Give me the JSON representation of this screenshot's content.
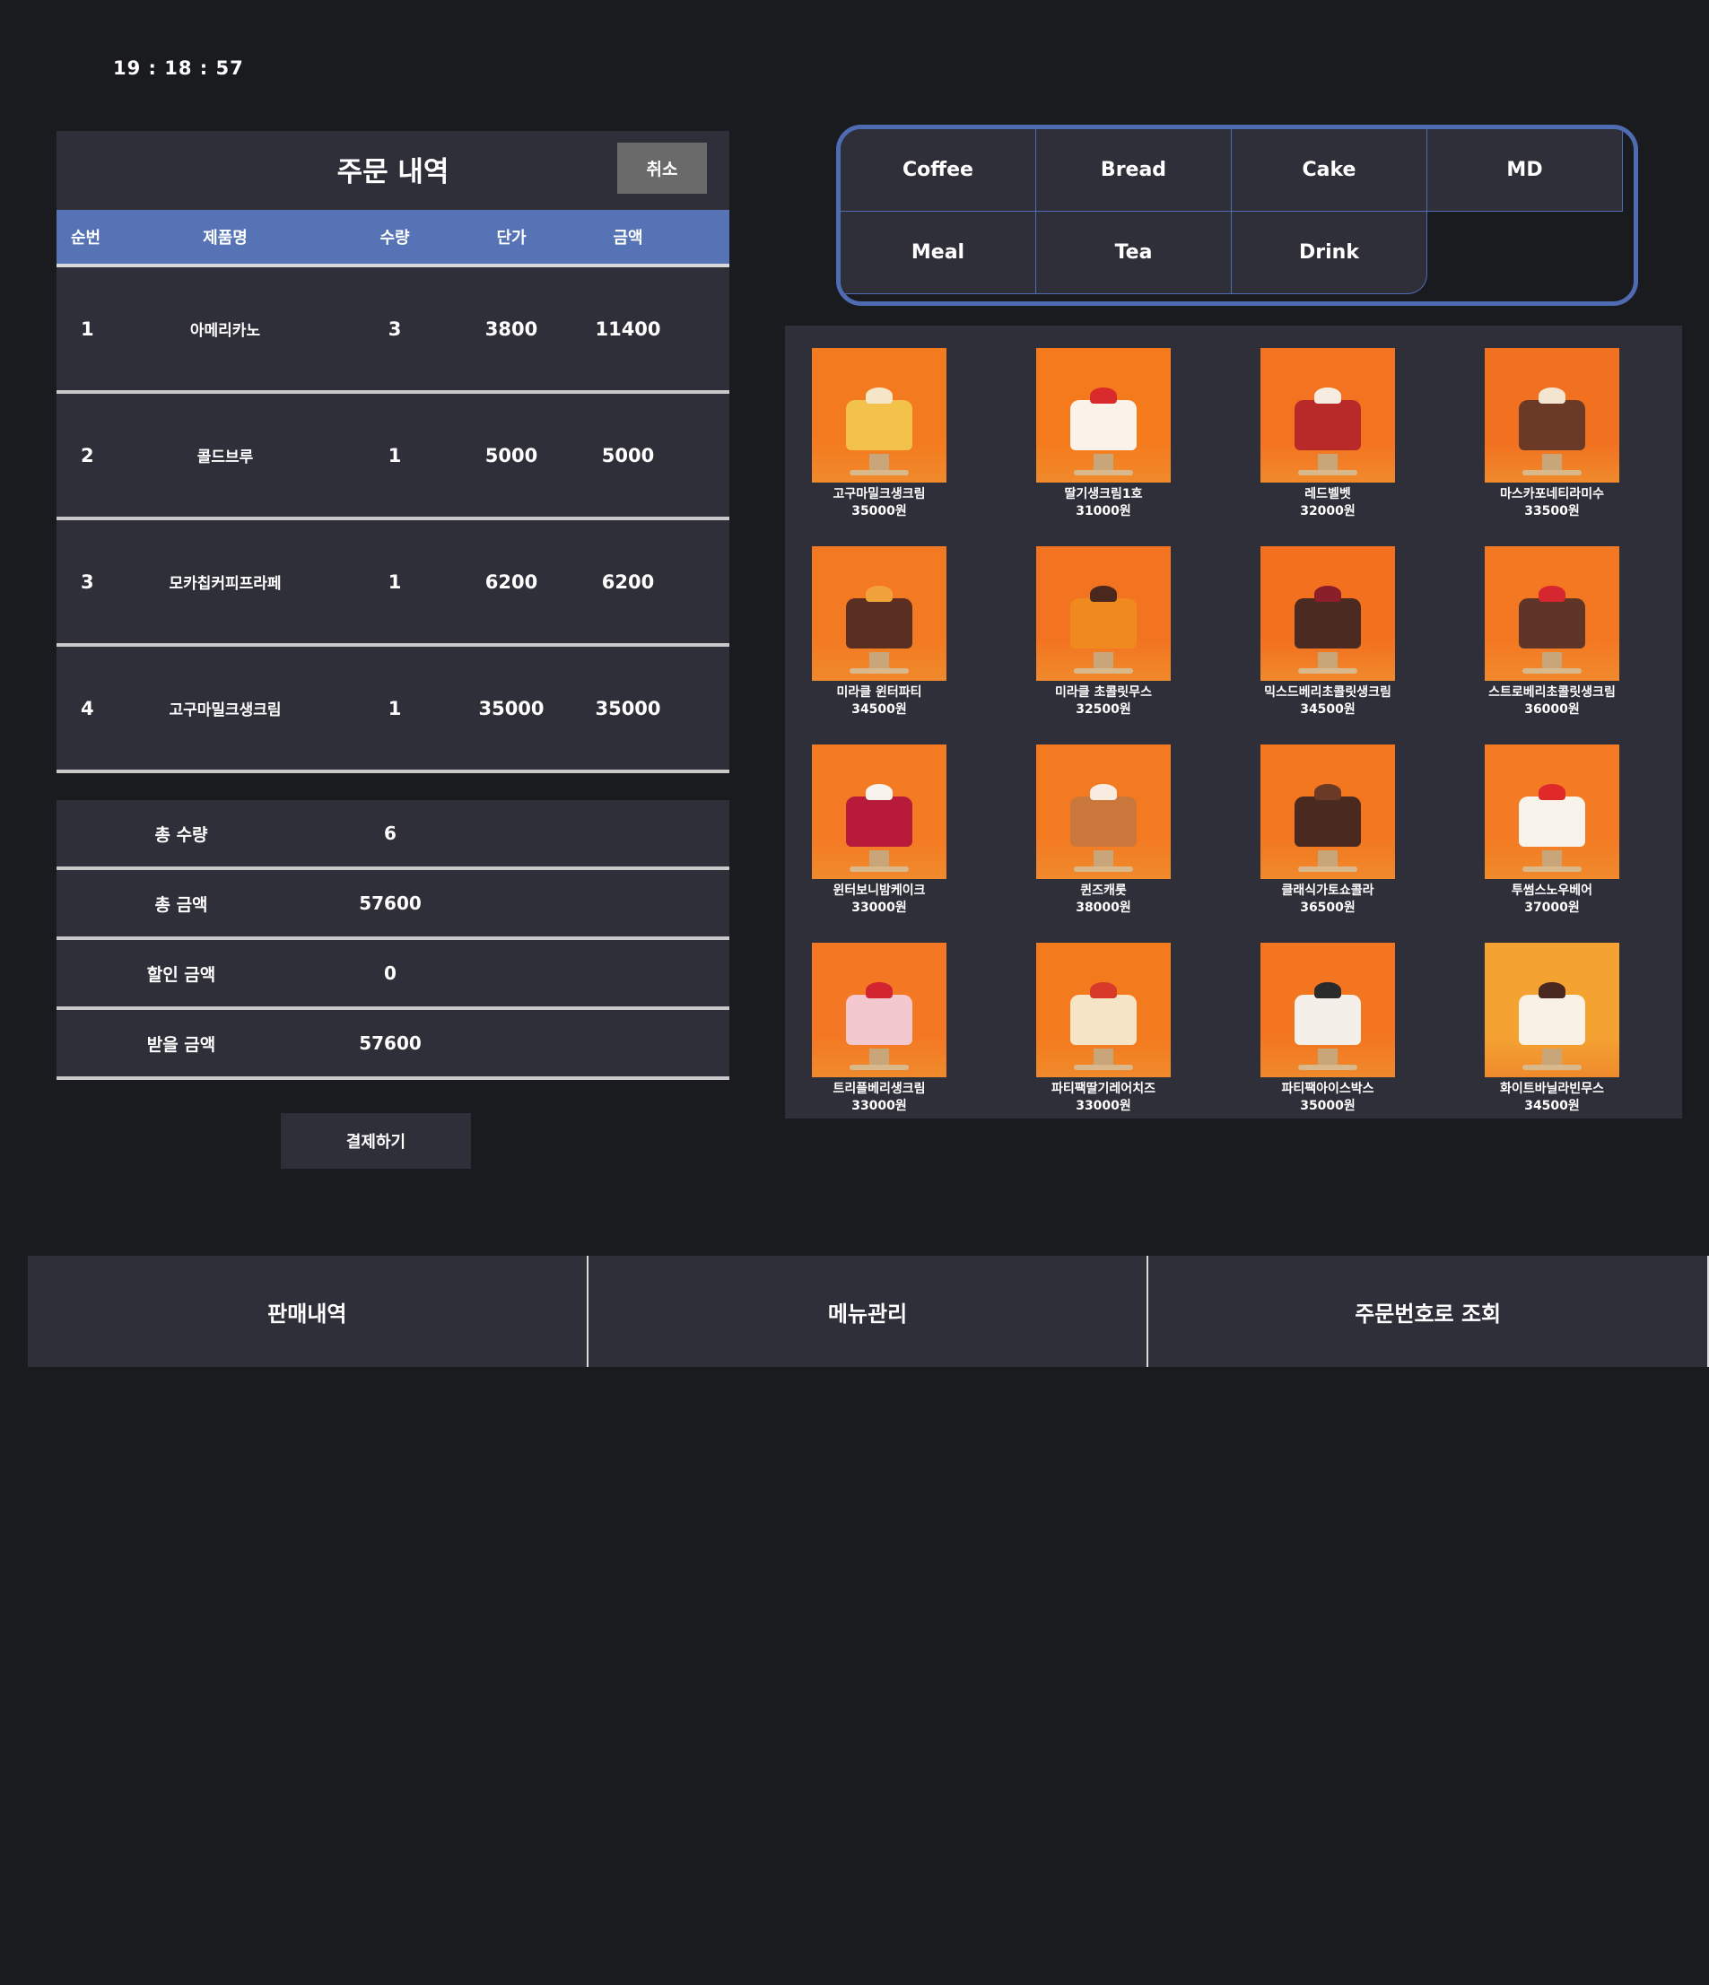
{
  "clock": "19 : 18 : 57",
  "order": {
    "title": "주문 내역",
    "cancel_label": "취소",
    "headers": {
      "no": "순번",
      "name": "제품명",
      "qty": "수량",
      "price": "단가",
      "amount": "금액"
    },
    "rows": [
      {
        "no": "1",
        "name": "아메리카노",
        "qty": "3",
        "price": "3800",
        "amount": "11400"
      },
      {
        "no": "2",
        "name": "콜드브루",
        "qty": "1",
        "price": "5000",
        "amount": "5000"
      },
      {
        "no": "3",
        "name": "모카칩커피프라페",
        "qty": "1",
        "price": "6200",
        "amount": "6200"
      },
      {
        "no": "4",
        "name": "고구마밀크생크림",
        "qty": "1",
        "price": "35000",
        "amount": "35000"
      }
    ]
  },
  "summary": [
    {
      "label": "총 수량",
      "value": "6"
    },
    {
      "label": "총 금액",
      "value": "57600"
    },
    {
      "label": "할인 금액",
      "value": "0"
    },
    {
      "label": "받을 금액",
      "value": "57600"
    }
  ],
  "pay_label": "결제하기",
  "categories": [
    "Coffee",
    "Bread",
    "Cake",
    "MD",
    "Meal",
    "Tea",
    "Drink"
  ],
  "products": [
    {
      "name": "고구마밀크생크림",
      "price": "35000원",
      "bg": "#f47a1f",
      "cake": "#f3c24a",
      "top": "#f5e6c8"
    },
    {
      "name": "딸기생크림1호",
      "price": "31000원",
      "bg": "#f57a1c",
      "cake": "#fbf3ea",
      "top": "#d92b2b"
    },
    {
      "name": "레드벨벳",
      "price": "32000원",
      "bg": "#f47320",
      "cake": "#b82a2a",
      "top": "#f7ece0"
    },
    {
      "name": "마스카포네티라미수",
      "price": "33500원",
      "bg": "#f27120",
      "cake": "#6b3a26",
      "top": "#f3e5cf"
    },
    {
      "name": "미라클 윈터파티",
      "price": "34500원",
      "bg": "#f37a22",
      "cake": "#5a2f22",
      "top": "#f2a23a"
    },
    {
      "name": "미라클 초콜릿무스",
      "price": "32500원",
      "bg": "#f37420",
      "cake": "#f08a1e",
      "top": "#4a281d"
    },
    {
      "name": "믹스드베리초콜릿생크림",
      "price": "34500원",
      "bg": "#f2701e",
      "cake": "#4b2a22",
      "top": "#8a1f2a"
    },
    {
      "name": "스트로베리초콜릿생크림",
      "price": "36000원",
      "bg": "#f47822",
      "cake": "#5e3527",
      "top": "#d6262f"
    },
    {
      "name": "윈터보니밤케이크",
      "price": "33000원",
      "bg": "#f47a24",
      "cake": "#b81a3a",
      "top": "#f7f2ec"
    },
    {
      "name": "퀸즈캐롯",
      "price": "38000원",
      "bg": "#f47a22",
      "cake": "#c9773a",
      "top": "#f7ecdf"
    },
    {
      "name": "클래식가토쇼콜라",
      "price": "36500원",
      "bg": "#f3771f",
      "cake": "#4a2a20",
      "top": "#6b3a26"
    },
    {
      "name": "투썸스노우베어",
      "price": "37000원",
      "bg": "#f47b23",
      "cake": "#f7f2ea",
      "top": "#e02a2a"
    },
    {
      "name": "트리플베리생크림",
      "price": "33000원",
      "bg": "#f47824",
      "cake": "#f3c9cf",
      "top": "#d2252f"
    },
    {
      "name": "파티팩딸기레어치즈",
      "price": "33000원",
      "bg": "#f47a1e",
      "cake": "#f5e5c6",
      "top": "#d83a2a"
    },
    {
      "name": "파티팩아이스박스",
      "price": "35000원",
      "bg": "#f37520",
      "cake": "#f4efe8",
      "top": "#2b2b2b"
    },
    {
      "name": "화이트바닐라빈무스",
      "price": "34500원",
      "bg": "#f4a232",
      "cake": "#f8f1e4",
      "top": "#4a2a20"
    }
  ],
  "bottom_nav": [
    "판매내역",
    "메뉴관리",
    "주문번호로 조회"
  ]
}
